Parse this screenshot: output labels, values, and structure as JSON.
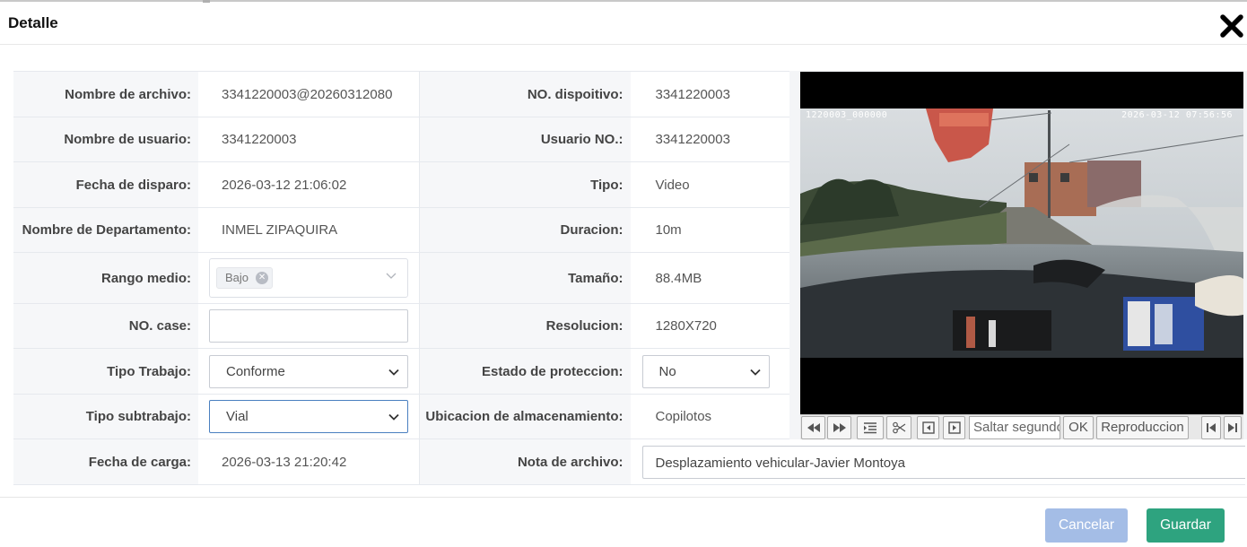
{
  "dialog": {
    "title": "Detalle",
    "close_icon": "close-icon"
  },
  "fields": {
    "file_name_label": "Nombre de archivo:",
    "file_name_value": "3341220003@20260312080",
    "device_no_label": "NO. dispoitivo:",
    "device_no_value": "3341220003",
    "user_name_label": "Nombre de usuario:",
    "user_name_value": "3341220003",
    "user_no_label": "Usuario NO.:",
    "user_no_value": "3341220003",
    "trigger_date_label": "Fecha de disparo:",
    "trigger_date_value": "2026-03-12 21:06:02",
    "type_label": "Tipo:",
    "type_value": "Video",
    "department_label": "Nombre de Departamento:",
    "department_value": "INMEL ZIPAQUIRA",
    "duration_label": "Duracion:",
    "duration_value": "10m",
    "mid_range_label": "Rango medio:",
    "mid_range_tag": "Bajo",
    "size_label": "Tamaño:",
    "size_value": "88.4MB",
    "case_no_label": "NO. case:",
    "case_no_value": "",
    "resolution_label": "Resolucion:",
    "resolution_value": "1280X720",
    "work_type_label": "Tipo Trabajo:",
    "work_type_value": "Conforme",
    "protection_label": "Estado de proteccion:",
    "protection_value": "No",
    "subwork_label": "Tipo subtrabajo:",
    "subwork_value": "Vial",
    "storage_label": "Ubicacion de almacenamiento:",
    "storage_value": "Copilotos",
    "upload_date_label": "Fecha de carga:",
    "upload_date_value": "2026-03-13 21:20:42",
    "file_note_label": "Nota de archivo:",
    "file_note_value": "Desplazamiento vehicular-Javier Montoya"
  },
  "player": {
    "osd_left": "1220003_000000",
    "osd_right": "2026-03-12  07:56:56",
    "seek_placeholder": "Saltar segundos",
    "ok_label": "OK",
    "playback_label": "Reproduccion",
    "icons": [
      "rewind-icon",
      "fast-forward-icon",
      "list-icon",
      "scissors-icon",
      "frame-back-icon",
      "frame-forward-icon",
      "skip-start-icon",
      "skip-end-icon"
    ]
  },
  "footer": {
    "cancel_label": "Cancelar",
    "save_label": "Guardar"
  },
  "colors": {
    "cancel": "#a4bde6",
    "save": "#2ea37f",
    "label_bg": "#f6f7f9",
    "active_border": "#4a7fc0"
  }
}
